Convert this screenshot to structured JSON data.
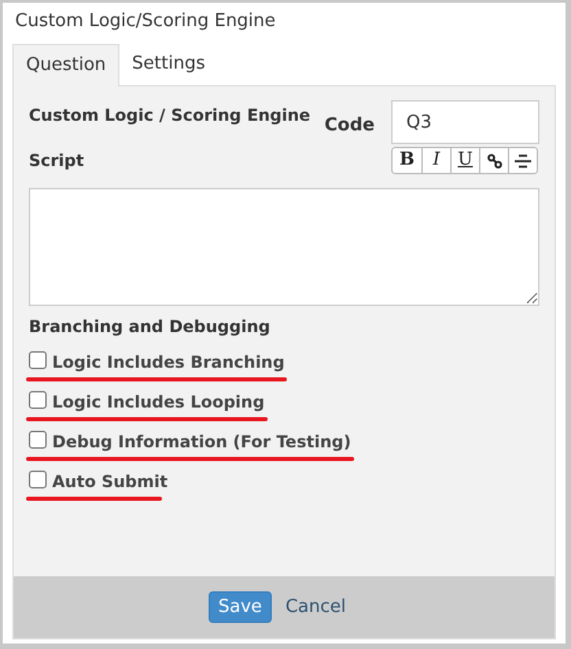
{
  "window": {
    "title": "Custom Logic/Scoring Engine"
  },
  "tabs": [
    {
      "label": "Question",
      "selected": true
    },
    {
      "label": "Settings",
      "selected": false
    }
  ],
  "heading": "Custom Logic / Scoring Engine",
  "code": {
    "label": "Code",
    "value": "Q3"
  },
  "script": {
    "label": "Script",
    "toolbar": [
      {
        "kind": "bold",
        "label": "B"
      },
      {
        "kind": "italic",
        "label": "I"
      },
      {
        "kind": "underline",
        "label": "U"
      },
      {
        "kind": "link"
      },
      {
        "kind": "align"
      }
    ]
  },
  "section_title": "Branching and Debugging",
  "options": [
    {
      "label": "Logic Includes Branching",
      "checked": false,
      "underlined": true
    },
    {
      "label": "Logic Includes Looping",
      "checked": false,
      "underlined": true
    },
    {
      "label": "Debug Information (For Testing)",
      "checked": false,
      "underlined": true
    },
    {
      "label": "Auto Submit",
      "checked": false,
      "underlined": true
    }
  ],
  "buttons": [
    {
      "kind": "primary",
      "label": "Save"
    },
    {
      "kind": "link",
      "label": "Cancel"
    }
  ]
}
